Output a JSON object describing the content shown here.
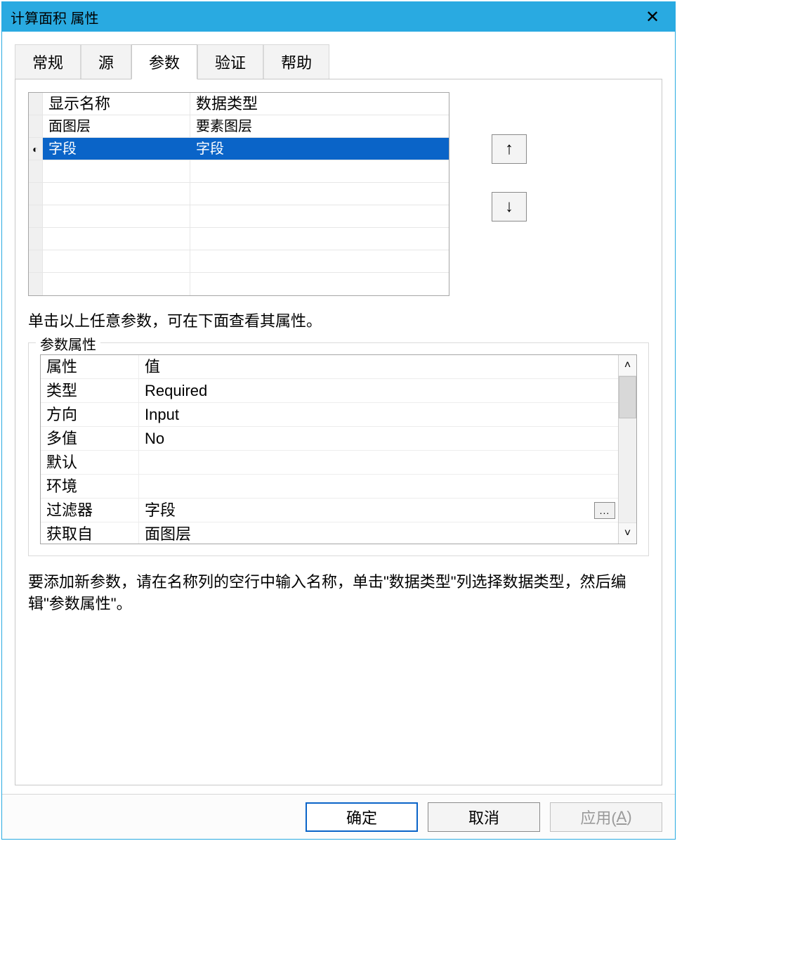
{
  "window": {
    "title": "计算面积 属性"
  },
  "tabs": {
    "general": "常规",
    "source": "源",
    "params": "参数",
    "validate": "验证",
    "help": "帮助"
  },
  "paramTable": {
    "header": {
      "c1": "显示名称",
      "c2": "数据类型"
    },
    "rows": [
      {
        "c1": "面图层",
        "c2": "要素图层",
        "selected": false,
        "marker": ""
      },
      {
        "c1": "字段",
        "c2": "字段",
        "selected": true,
        "marker": "◐"
      }
    ]
  },
  "hint": "单击以上任意参数，可在下面查看其属性。",
  "fieldsetTitle": "参数属性",
  "propTable": {
    "header": {
      "c1": "属性",
      "c2": "值"
    },
    "rows": [
      {
        "k": "类型",
        "v": "Required"
      },
      {
        "k": "方向",
        "v": "Input"
      },
      {
        "k": "多值",
        "v": "No"
      },
      {
        "k": "默认",
        "v": ""
      },
      {
        "k": "环境",
        "v": ""
      },
      {
        "k": "过滤器",
        "v": "字段",
        "more": true
      },
      {
        "k": "获取自",
        "v": "面图层"
      }
    ]
  },
  "helpText": "要添加新参数，请在名称列的空行中输入名称，单击\"数据类型\"列选择数据类型，然后编辑\"参数属性\"。",
  "buttons": {
    "ok": "确定",
    "cancel": "取消",
    "apply_prefix": "应用(",
    "apply_key": "A",
    "apply_suffix": ")"
  }
}
